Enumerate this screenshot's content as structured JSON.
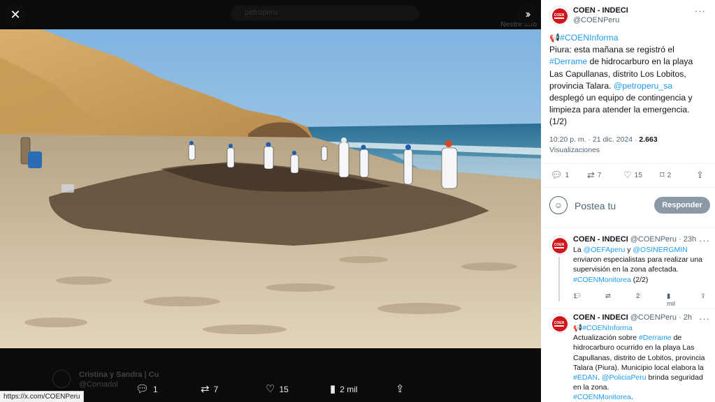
{
  "viewer": {
    "close_icon": "close-icon",
    "expand_icon": "chevron-double-right-icon",
    "ghost_search_text": "petroperu",
    "ghost_nav_text": "Nestre Info",
    "ghost_user": "Cristina y Sandra | Cu",
    "ghost_user_handle": "@Cornadol",
    "actions": {
      "reply_count": "1",
      "retweet_count": "7",
      "like_count": "15",
      "views_count": "2 mil"
    },
    "status_url": "https://x.com/COENPeru"
  },
  "tweet": {
    "author_name": "COEN - INDECI",
    "author_handle": "@COENPeru",
    "avatar_text": "COEN",
    "hashtag_line": "📢#COENInforma",
    "text_prefix": "Piura: esta mañana se registró el ",
    "hashtag_derrame": "#Derrame",
    "text_mid": " de hidrocarburo en la playa Las Capullanas, distrito Los Lobitos, provincia Talara. ",
    "mention_petroperu": "@petroperu_sa",
    "text_suffix": " desplegó un equipo de contingencia y limpieza para atender la emergencia. (1/2)",
    "timestamp": "10:20 p. m. · 21 dic. 2024 · ",
    "views": "2.663",
    "views_label": "Visualizaciones",
    "stats": {
      "replies": "1",
      "retweets": "7",
      "likes": "15",
      "bookmarks": "2"
    }
  },
  "compose": {
    "placeholder": "Postea tu",
    "reply_button": "Responder"
  },
  "replies": [
    {
      "name": "COEN - INDECI",
      "handle_time": "@COENPeru · 23h",
      "text_1": "La ",
      "mention_1": "@OEFAperu",
      "text_2": " y ",
      "mention_2": "@OSINERGMIN",
      "text_3": " enviaron especialistas para realizar una supervisión en la zona afectada.",
      "hashtag": "#COENMonitorea",
      "text_4": " (2/2)",
      "replies": "1",
      "likes": "2",
      "views": "1 mil"
    },
    {
      "name": "COEN - INDECI",
      "handle_time": "@COENPeru · 2h",
      "hashtag_line": "📢#COENInforma",
      "text_1": "Actualización sobre ",
      "hashtag_derrame": "#Derrame",
      "text_2": " de hidrocarburo ocurrido en la playa Las Capullanas, distrito de Lobitos, provincia Talara (Piura). Municipio local elabora la ",
      "hashtag_edan": "#EDAN",
      "text_3": ". ",
      "mention_policia": "@PoliciaPeru",
      "text_4": " brinda seguridad en la zona.",
      "hashtag_monitorea": "#COENMonitorea",
      "text_5": "."
    }
  ]
}
